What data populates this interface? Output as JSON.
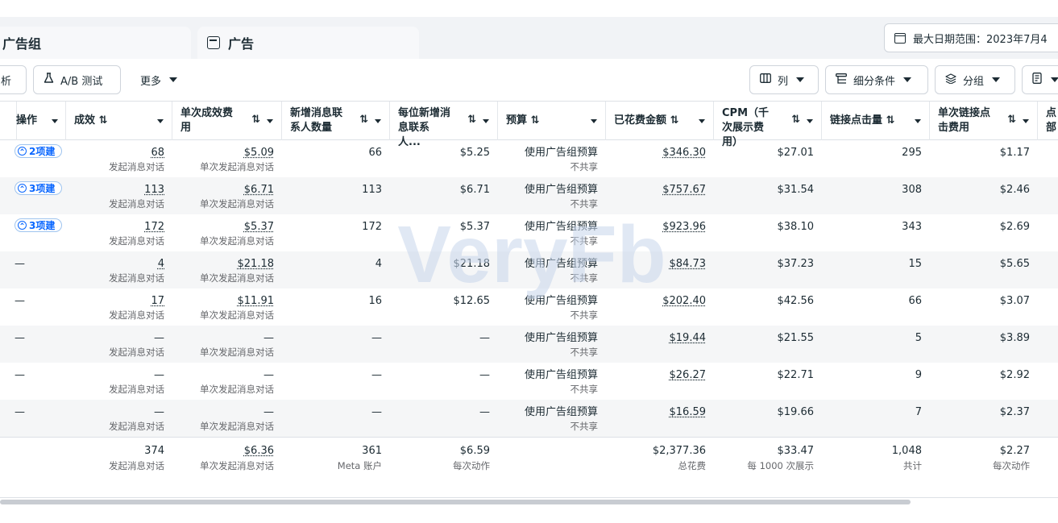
{
  "tabs": [
    {
      "label": "广告组"
    },
    {
      "label": "广告"
    }
  ],
  "date_range": {
    "label": "最大日期范围：2023年7月4"
  },
  "toolbar": {
    "analyze_label": "析",
    "ab_test_label": "A/B 测试",
    "more_label": "更多",
    "columns_label": "列",
    "breakdown_label": "细分条件",
    "group_label": "分组"
  },
  "columns": [
    {
      "label": "操作"
    },
    {
      "label": "成效 ⇅"
    },
    {
      "label": "单次成效费用"
    },
    {
      "label": "新增消息联系人数量"
    },
    {
      "label": "每位新增消息联系人..."
    },
    {
      "label": "预算 ⇅"
    },
    {
      "label": "已花费金额 ⇅"
    },
    {
      "label": "CPM（千次展示费用）"
    },
    {
      "label": "链接点击量 ⇅"
    },
    {
      "label": "单次链接点击费用"
    },
    {
      "label": "点部"
    }
  ],
  "sort_glyph": "⇅",
  "rows": [
    {
      "op": "2项建",
      "results": "68",
      "results_sub": "发起消息对话",
      "cpr": "$5.09",
      "cpr_sub": "单次发起消息对话",
      "new_contacts": "66",
      "cost_per_contact": "$5.25",
      "budget": "使用广告组预算",
      "budget_sub": "不共享",
      "spent": "$346.30",
      "cpm": "$27.01",
      "clicks": "295",
      "cpc": "$1.17"
    },
    {
      "op": "3项建",
      "results": "113",
      "results_sub": "发起消息对话",
      "cpr": "$6.71",
      "cpr_sub": "单次发起消息对话",
      "new_contacts": "113",
      "cost_per_contact": "$6.71",
      "budget": "使用广告组预算",
      "budget_sub": "不共享",
      "spent": "$757.67",
      "cpm": "$31.54",
      "clicks": "308",
      "cpc": "$2.46"
    },
    {
      "op": "3项建",
      "results": "172",
      "results_sub": "发起消息对话",
      "cpr": "$5.37",
      "cpr_sub": "单次发起消息对话",
      "new_contacts": "172",
      "cost_per_contact": "$5.37",
      "budget": "使用广告组预算",
      "budget_sub": "不共享",
      "spent": "$923.96",
      "cpm": "$38.10",
      "clicks": "343",
      "cpc": "$2.69"
    },
    {
      "op": "—",
      "results": "4",
      "results_sub": "发起消息对话",
      "cpr": "$21.18",
      "cpr_sub": "单次发起消息对话",
      "new_contacts": "4",
      "cost_per_contact": "$21.18",
      "budget": "使用广告组预算",
      "budget_sub": "不共享",
      "spent": "$84.73",
      "cpm": "$37.23",
      "clicks": "15",
      "cpc": "$5.65"
    },
    {
      "op": "—",
      "results": "17",
      "results_sub": "发起消息对话",
      "cpr": "$11.91",
      "cpr_sub": "单次发起消息对话",
      "new_contacts": "16",
      "cost_per_contact": "$12.65",
      "budget": "使用广告组预算",
      "budget_sub": "不共享",
      "spent": "$202.40",
      "cpm": "$42.56",
      "clicks": "66",
      "cpc": "$3.07"
    },
    {
      "op": "—",
      "results": "—",
      "results_sub": "发起消息对话",
      "cpr": "—",
      "cpr_sub": "单次发起消息对话",
      "new_contacts": "—",
      "cost_per_contact": "—",
      "budget": "使用广告组预算",
      "budget_sub": "不共享",
      "spent": "$19.44",
      "cpm": "$21.55",
      "clicks": "5",
      "cpc": "$3.89"
    },
    {
      "op": "—",
      "results": "—",
      "results_sub": "发起消息对话",
      "cpr": "—",
      "cpr_sub": "单次发起消息对话",
      "new_contacts": "—",
      "cost_per_contact": "—",
      "budget": "使用广告组预算",
      "budget_sub": "不共享",
      "spent": "$26.27",
      "cpm": "$22.71",
      "clicks": "9",
      "cpc": "$2.92"
    },
    {
      "op": "—",
      "results": "—",
      "results_sub": "发起消息对话",
      "cpr": "—",
      "cpr_sub": "单次发起消息对话",
      "new_contacts": "—",
      "cost_per_contact": "—",
      "budget": "使用广告组预算",
      "budget_sub": "不共享",
      "spent": "$16.59",
      "cpm": "$19.66",
      "clicks": "7",
      "cpc": "$2.37"
    }
  ],
  "totals": {
    "results": "374",
    "results_sub": "发起消息对话",
    "cpr": "$6.36",
    "cpr_sub": "单次发起消息对话",
    "new_contacts": "361",
    "new_contacts_sub": "Meta 账户",
    "cost_per_contact": "$6.59",
    "cost_per_contact_sub": "每次动作",
    "spent": "$2,377.36",
    "spent_sub": "总花费",
    "cpm": "$33.47",
    "cpm_sub": "每 1000 次展示",
    "clicks": "1,048",
    "clicks_sub": "共计",
    "cpc": "$2.27",
    "cpc_sub": "每次动作"
  },
  "watermark": {
    "text": "VeryFb",
    "color": "#c8d6ec"
  },
  "colors": {
    "accent": "#0866ff",
    "alt_row": "#f5f6f7",
    "tabbar": "#f1f3f6"
  }
}
